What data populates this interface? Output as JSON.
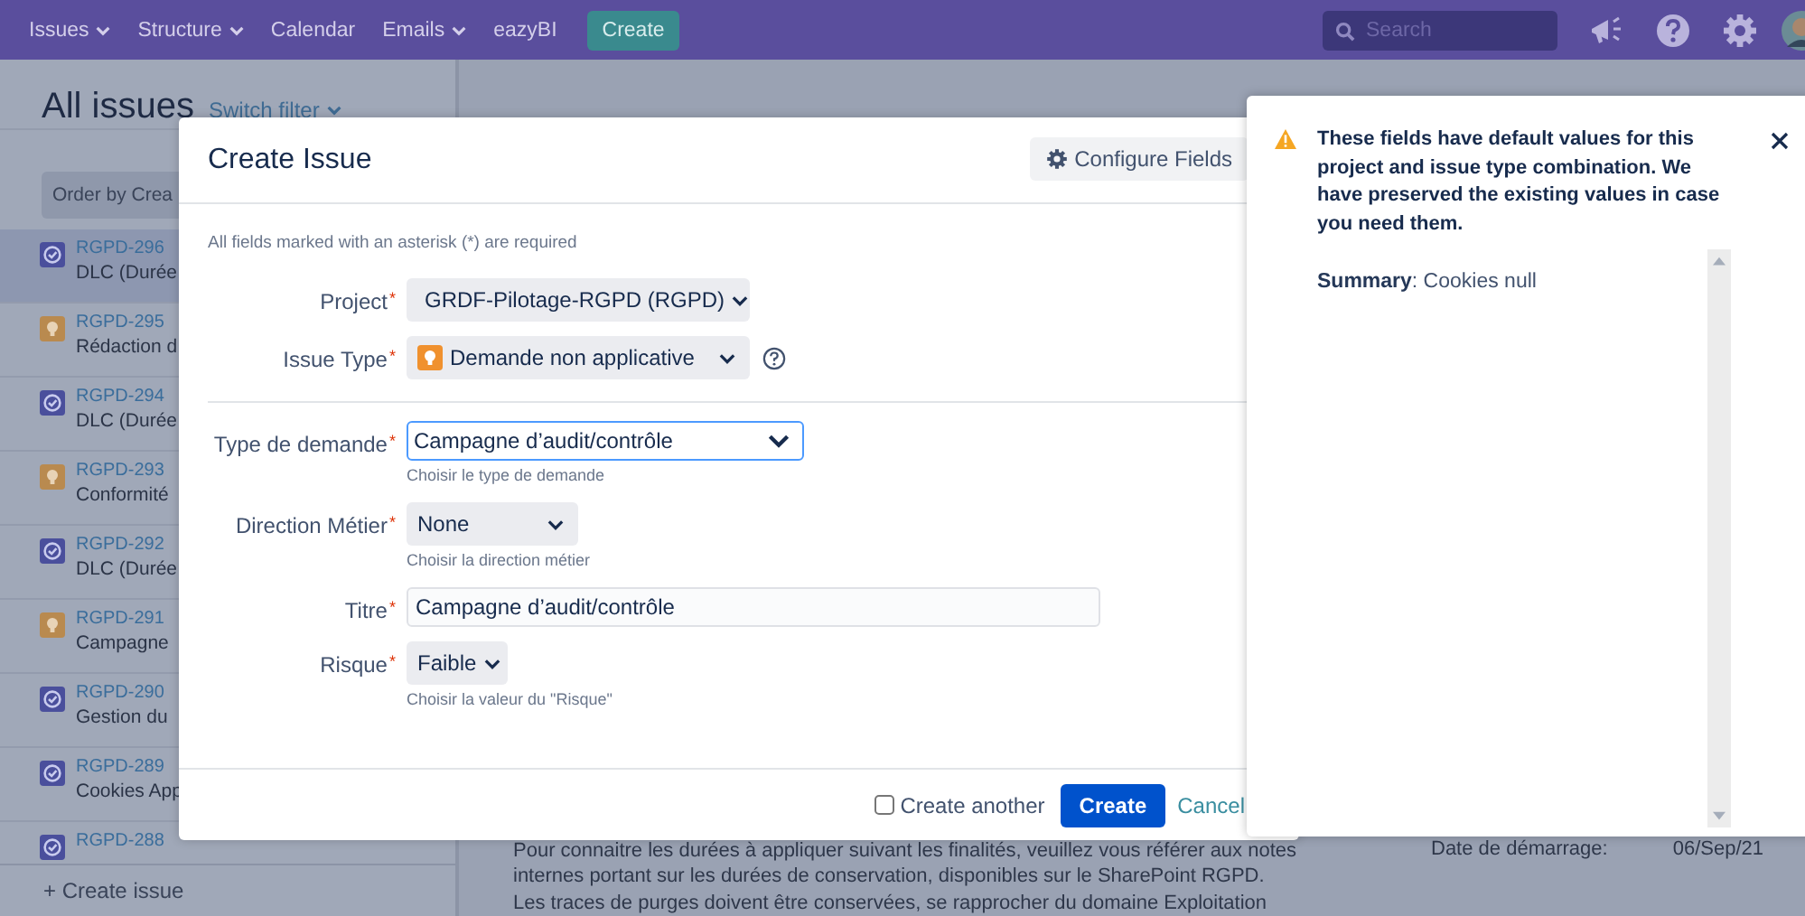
{
  "nav": {
    "items": [
      {
        "label": "Issues",
        "dropdown": true
      },
      {
        "label": "Structure",
        "dropdown": true
      },
      {
        "label": "Calendar",
        "dropdown": false
      },
      {
        "label": "Emails",
        "dropdown": true
      },
      {
        "label": "eazyBI",
        "dropdown": false
      }
    ],
    "create_button": "Create",
    "search": {
      "placeholder": "Search"
    }
  },
  "page": {
    "title": "All issues",
    "switch_filter": "Switch filter",
    "order_button": "Order by Crea",
    "issues": [
      {
        "key": "RGPD-296",
        "summary": "DLC (Durée",
        "kind": "task",
        "selected": true
      },
      {
        "key": "RGPD-295",
        "summary": "Rédaction d",
        "kind": "idea",
        "selected": false
      },
      {
        "key": "RGPD-294",
        "summary": "DLC (Durée",
        "kind": "task",
        "selected": false
      },
      {
        "key": "RGPD-293",
        "summary": "Conformité",
        "kind": "idea",
        "selected": false
      },
      {
        "key": "RGPD-292",
        "summary": "DLC (Durée",
        "kind": "task",
        "selected": false
      },
      {
        "key": "RGPD-291",
        "summary": "Campagne",
        "kind": "idea",
        "selected": false
      },
      {
        "key": "RGPD-290",
        "summary": "Gestion du",
        "kind": "task",
        "selected": false
      },
      {
        "key": "RGPD-289",
        "summary": "Cookies App",
        "kind": "task",
        "selected": false
      },
      {
        "key": "RGPD-288",
        "kind": "task",
        "selected": false
      }
    ],
    "create_issue": "+ Create issue",
    "description_lines": [
      "Pour connaitre les durées à appliquer suivant les finalités, veuillez vous référer aux notes",
      "internes portant sur les durées de conservation, disponibles sur le SharePoint RGPD.",
      "Les traces de purges doivent être conservées, se rapprocher du domaine Exploitation"
    ],
    "date_field": {
      "label": "Date de démarrage:",
      "value": "06/Sep/21"
    }
  },
  "modal": {
    "title": "Create Issue",
    "configure_button": "Configure Fields",
    "required_note": "All fields marked with an asterisk (*) are required",
    "fields": [
      {
        "kind": "project",
        "label": "Project",
        "required_mark": "*",
        "value": "GRDF-Pilotage-RGPD (RGPD)"
      },
      {
        "kind": "issuetype",
        "label": "Issue Type",
        "required_mark": "*",
        "value": "Demande non applicative",
        "help": true,
        "divider_after": true
      },
      {
        "kind": "select",
        "label": "Type de demande",
        "required_mark": "*",
        "value": "Campagne d’audit/contrôle",
        "focused": true,
        "hint": "Choisir le type de demande"
      },
      {
        "kind": "select",
        "label": "Direction Métier",
        "required_mark": "*",
        "value": "None",
        "hint": "Choisir la direction métier"
      },
      {
        "kind": "text",
        "label": "Titre",
        "required_mark": "*",
        "value": "Campagne d’audit/contrôle"
      },
      {
        "kind": "select",
        "label": "Risque",
        "required_mark": "*",
        "value": "Faible",
        "hint": "Choisir la valeur du \"Risque\""
      }
    ],
    "create_another": {
      "label": "Create another",
      "checked": false
    },
    "create_button": "Create",
    "cancel": "Cancel"
  },
  "notice": {
    "message": "These fields have default values for this project and issue type combination. We have preserved the existing values in case you need them.",
    "items": [
      "**Summary**: Cookies null"
    ]
  }
}
